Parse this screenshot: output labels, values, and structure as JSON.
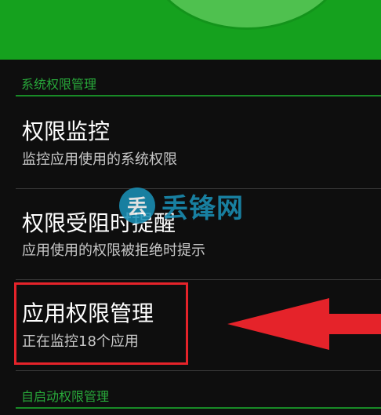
{
  "sections": [
    {
      "id": "system",
      "header": "系统权限管理"
    },
    {
      "id": "autostart",
      "header": "自启动权限管理"
    }
  ],
  "items": [
    {
      "title": "权限监控",
      "subtitle": "监控应用使用的系统权限"
    },
    {
      "title": "权限受阻时提醒",
      "subtitle": "应用使用的权限被拒绝时提示"
    },
    {
      "title": "应用权限管理",
      "subtitle": "正在监控18个应用"
    }
  ],
  "watermark": {
    "logo_char": "丢",
    "brand": "丢锋网"
  },
  "colors": {
    "banner_green": "#15a11e",
    "section_green": "#28a83a",
    "highlight_red": "#e5232a",
    "arrow_red": "#e5232a",
    "watermark_blue": "#1a8fb5",
    "background": "#0e0e0e"
  },
  "icons": [
    "app-logo-circle-icon",
    "red-arrow-icon"
  ]
}
